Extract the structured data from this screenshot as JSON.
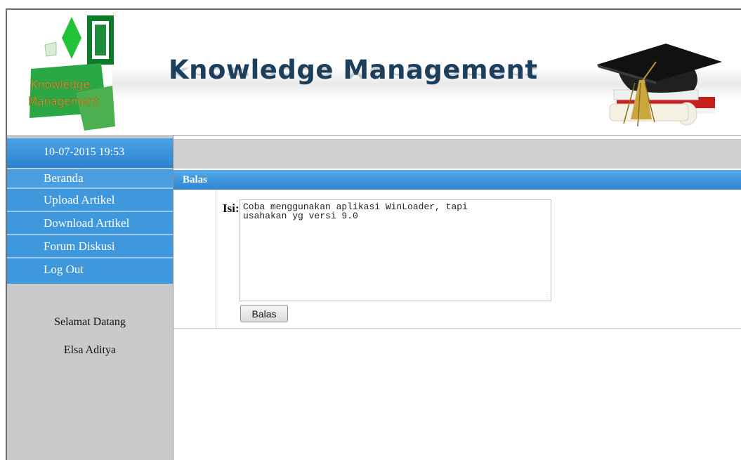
{
  "header": {
    "logo_line1": "Knowledge",
    "logo_line2": "Management",
    "title": "Knowledge Management",
    "banner_image": "graduation-cap-books-icon"
  },
  "sidebar": {
    "datetime": "10-07-2015 19:53",
    "menu": [
      {
        "label": "Beranda"
      },
      {
        "label": "Upload Artikel"
      },
      {
        "label": "Download Artikel"
      },
      {
        "label": "Forum Diskusi"
      },
      {
        "label": "Log Out"
      }
    ],
    "welcome": "Selamat Datang",
    "username": "Elsa Aditya"
  },
  "panel": {
    "title": "Balas",
    "field_label": "Isi:",
    "content": "Coba menggunakan aplikasi WinLoader, tapi\nusahakan yg versi 9.0",
    "button_label": "Balas"
  },
  "colors": {
    "menu_blue": "#3f98dc",
    "sidebar_gray": "#c9c9c9",
    "title_navy": "#1e3f5c",
    "logo_green": "#1e9a3c"
  }
}
